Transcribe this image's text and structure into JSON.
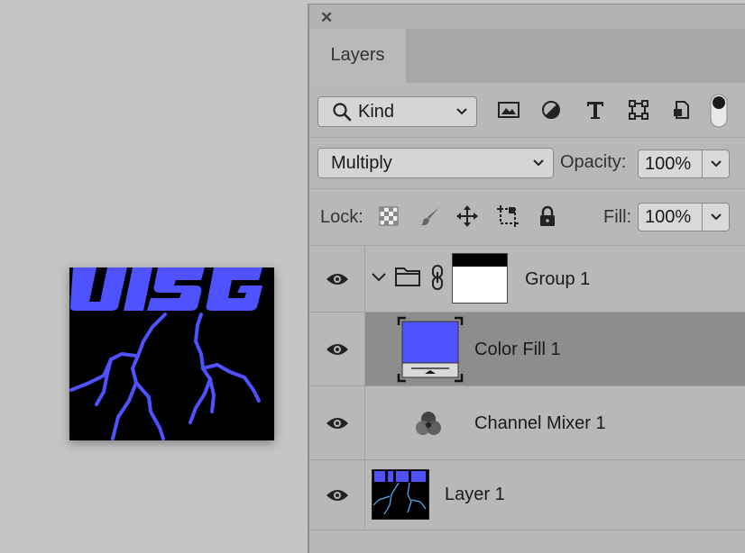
{
  "canvas": {
    "title_art": "UISG"
  },
  "panel": {
    "close_glyph": "✕",
    "tab_label": "Layers",
    "kind_filter": {
      "value": "Kind"
    },
    "filter_icons": [
      "image-filter-icon",
      "adjustment-filter-icon",
      "type-filter-icon",
      "shape-filter-icon",
      "smart-object-filter-icon",
      "filter-toggle-icon"
    ],
    "blend_mode": {
      "value": "Multiply"
    },
    "opacity": {
      "label": "Opacity:",
      "value": "100%"
    },
    "lock": {
      "label": "Lock:"
    },
    "fill": {
      "label": "Fill:",
      "value": "100%"
    },
    "colors": {
      "fill_blue": "#4e52ff",
      "selected_row": "#8d8d8d",
      "panel_bg": "#b8b8b8"
    }
  },
  "layers": [
    {
      "name": "Group 1",
      "type": "group",
      "visible": true
    },
    {
      "name": "Color Fill 1",
      "type": "color-fill",
      "visible": true,
      "selected": true
    },
    {
      "name": "Channel Mixer 1",
      "type": "adjustment",
      "visible": true
    },
    {
      "name": "Layer 1",
      "type": "pixel",
      "visible": true
    }
  ]
}
